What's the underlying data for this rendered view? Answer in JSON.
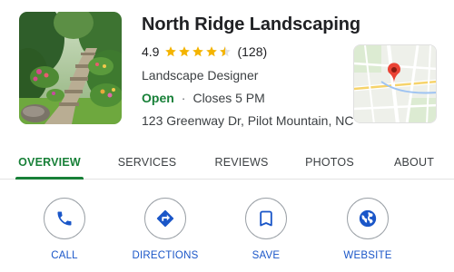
{
  "business": {
    "name": "North Ridge Landscaping",
    "rating": "4.9",
    "stars": 4.5,
    "review_count": "(128)",
    "category": "Landscape Designer",
    "open_status": "Open",
    "separator": "·",
    "closes": "Closes 5 PM",
    "address": "123 Greenway Dr, Pilot Mountain, NC"
  },
  "tabs": [
    {
      "label": "OVERVIEW",
      "active": true
    },
    {
      "label": "SERVICES",
      "active": false
    },
    {
      "label": "REVIEWS",
      "active": false
    },
    {
      "label": "PHOTOS",
      "active": false
    },
    {
      "label": "ABOUT",
      "active": false
    }
  ],
  "actions": [
    {
      "label": "CALL",
      "icon": "phone-icon"
    },
    {
      "label": "DIRECTIONS",
      "icon": "directions-icon"
    },
    {
      "label": "SAVE",
      "icon": "bookmark-icon"
    },
    {
      "label": "WEBSITE",
      "icon": "globe-icon"
    }
  ],
  "colors": {
    "accent_green": "#188038",
    "action_blue": "#1a56c8",
    "star_gold": "#f4b400",
    "map_pin_red": "#ea4335"
  }
}
